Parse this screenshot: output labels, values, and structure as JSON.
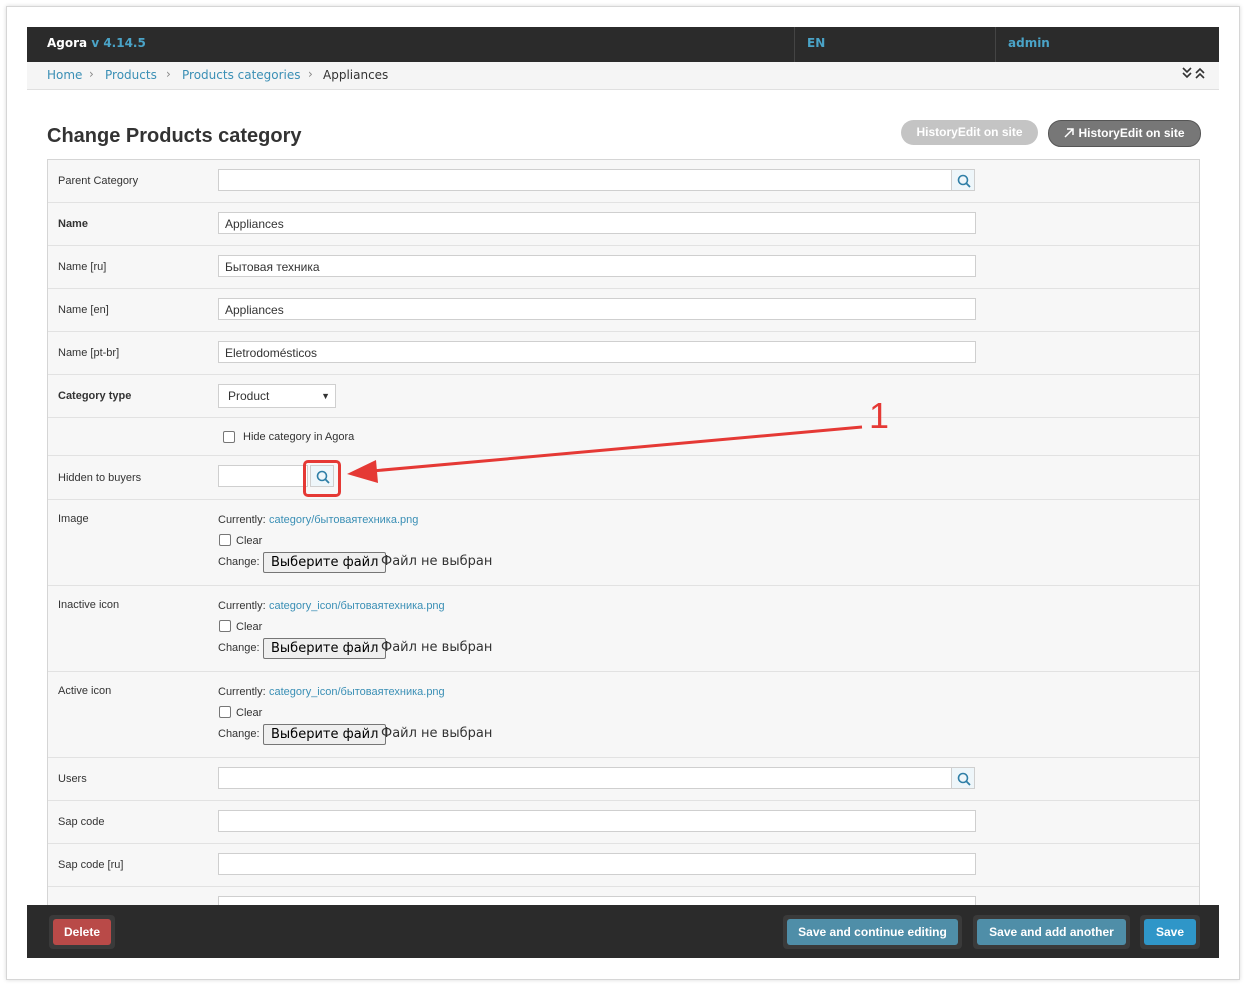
{
  "app": {
    "name": "Agora",
    "version": "v 4.14.5"
  },
  "topbar": {
    "language": "EN",
    "user": "admin"
  },
  "breadcrumb": [
    "Home",
    "Products",
    "Products categories",
    "Appliances"
  ],
  "breadcrumb_toggle": "»«",
  "page_title": "Change Products category",
  "header_buttons": {
    "history_disabled": "HistoryEdit on site",
    "history_active": "HistoryEdit on site"
  },
  "fields": {
    "parent_category": {
      "label": "Parent Category",
      "value": ""
    },
    "name": {
      "label": "Name",
      "value": "Appliances"
    },
    "name_ru": {
      "label": "Name [ru]",
      "value": "Бытовая техника"
    },
    "name_en": {
      "label": "Name [en]",
      "value": "Appliances"
    },
    "name_ptbr": {
      "label": "Name [pt-br]",
      "value": "Eletrodomésticos"
    },
    "category_type": {
      "label": "Category type",
      "value": "Product"
    },
    "hide_category": {
      "label": "Hide category in Agora",
      "checked": false
    },
    "hidden_to_buyers": {
      "label": "Hidden to buyers",
      "value": ""
    },
    "image": {
      "label": "Image",
      "currently_label": "Currently:",
      "currently_value": "category/бытоваятехника.png",
      "clear_label": "Clear",
      "change_label": "Change:",
      "file_button": "Выберите файл",
      "file_status": "Файл не выбран"
    },
    "inactive_icon": {
      "label": "Inactive icon",
      "currently_label": "Currently:",
      "currently_value": "category_icon/бытоваятехника.png",
      "clear_label": "Clear",
      "change_label": "Change:",
      "file_button": "Выберите файл",
      "file_status": "Файл не выбран"
    },
    "active_icon": {
      "label": "Active icon",
      "currently_label": "Currently:",
      "currently_value": "category_icon/бытоваятехника.png",
      "clear_label": "Clear",
      "change_label": "Change:",
      "file_button": "Выберите файл",
      "file_status": "Файл не выбран"
    },
    "users": {
      "label": "Users",
      "value": ""
    },
    "sap_code": {
      "label": "Sap code",
      "value": ""
    },
    "sap_code_ru": {
      "label": "Sap code [ru]",
      "value": ""
    }
  },
  "bottom_buttons": {
    "delete": "Delete",
    "save_continue": "Save and continue editing",
    "save_add": "Save and add another",
    "save": "Save"
  },
  "annotation": {
    "number": "1",
    "color": "#e53935"
  },
  "colors": {
    "accent": "#3a8fb5",
    "topbar": "#2b2b2b",
    "delete": "#b94a48",
    "save_alt": "#4f8ea8",
    "save": "#2f96c8"
  }
}
